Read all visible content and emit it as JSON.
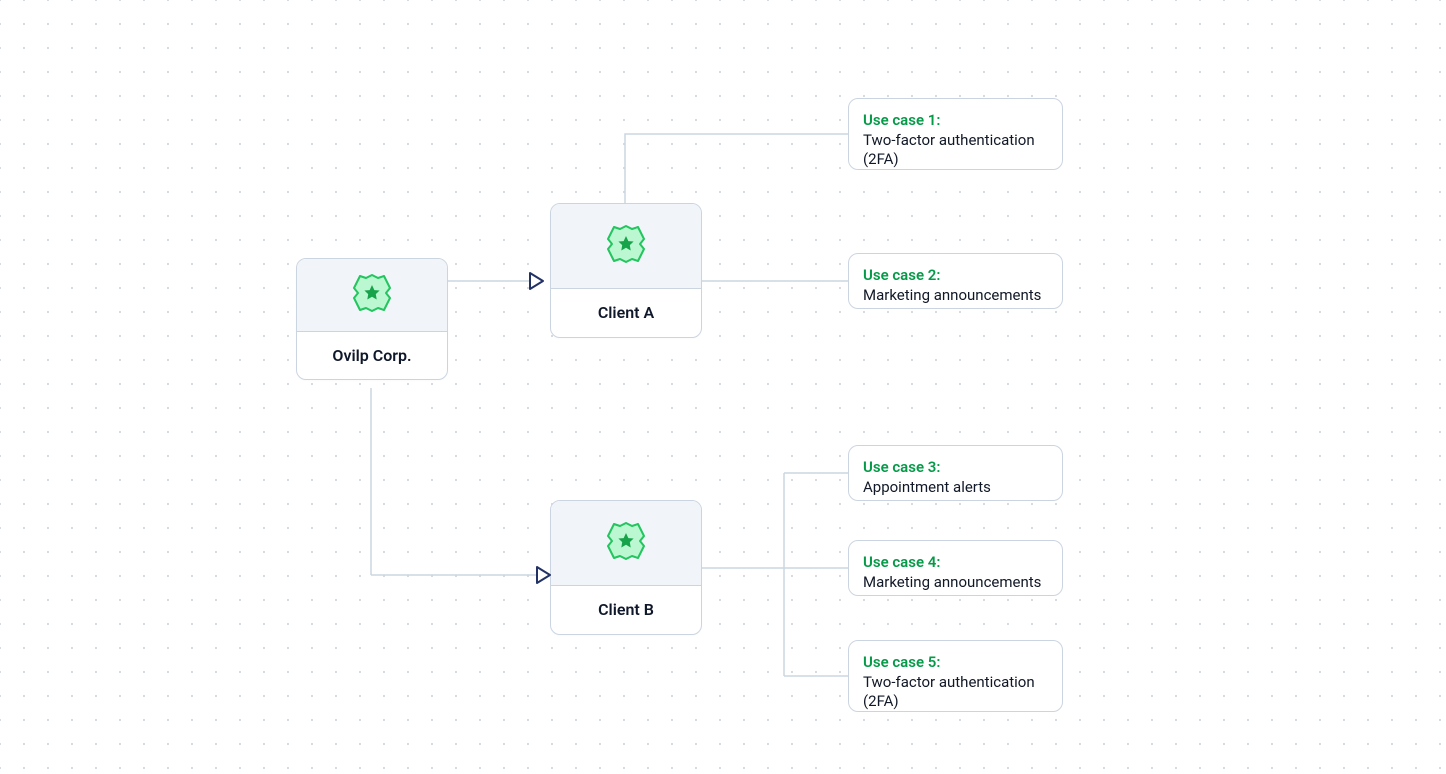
{
  "diagram": {
    "root": {
      "label": "Ovilp Corp."
    },
    "clientA": {
      "label": "Client A"
    },
    "clientB": {
      "label": "Client B"
    },
    "usecases": {
      "uc1": {
        "title": "Use case 1:",
        "desc": "Two-factor authentication (2FA)"
      },
      "uc2": {
        "title": "Use case 2:",
        "desc": "Marketing announcements"
      },
      "uc3": {
        "title": "Use case 3:",
        "desc": "Appointment alerts"
      },
      "uc4": {
        "title": "Use case 4:",
        "desc": "Marketing announcements"
      },
      "uc5": {
        "title": "Use case 5:",
        "desc": "Two-factor authentication (2FA)"
      }
    },
    "colors": {
      "lineColor": "#cbd5e1",
      "lineDarkColor": "#94a3b8",
      "arrowColor": "#233266",
      "accentGreen": "#22c55e",
      "accentGreenDark": "#059a48",
      "badgeFill": "#bbf7d0"
    }
  }
}
